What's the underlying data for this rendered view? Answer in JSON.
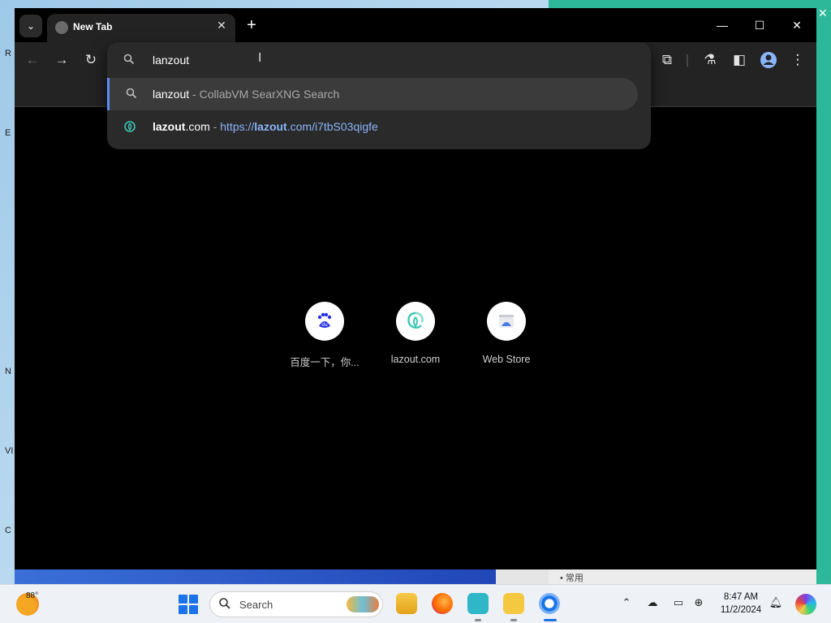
{
  "desktop": {
    "left_glyphs": [
      "R",
      "E",
      "N",
      "VI",
      "C"
    ]
  },
  "browser": {
    "tab": {
      "title": "New Tab"
    },
    "omnibox": {
      "value": "lanzout",
      "suggestions": [
        {
          "main": "lanzout",
          "sub": " - CollabVM SearXNG Search"
        },
        {
          "host_bold": "lazout",
          "host_rest": ".com",
          "sep": " - ",
          "url_prefix": "https://",
          "url_bold": "lazout",
          "url_rest": ".com/i7tbS03qigfe"
        }
      ]
    },
    "shortcuts": [
      {
        "label": "百度一下，你...",
        "icon": "baidu-icon",
        "glyph": "du"
      },
      {
        "label": "lazout.com",
        "icon": "lazout-icon",
        "glyph": "G"
      },
      {
        "label": "Web Store",
        "icon": "web-store-icon",
        "glyph": ""
      }
    ]
  },
  "background_doc": {
    "text": "• 常用"
  },
  "taskbar": {
    "temperature": "88°",
    "search_placeholder": "Search",
    "clock_time": "8:47 AM",
    "clock_date": "11/2/2024"
  },
  "colors": {
    "accent_blue": "#8ab4f8",
    "active_indicator": "#5b8ef0",
    "window_bg": "#000000",
    "toolbar_bg": "#232323"
  }
}
